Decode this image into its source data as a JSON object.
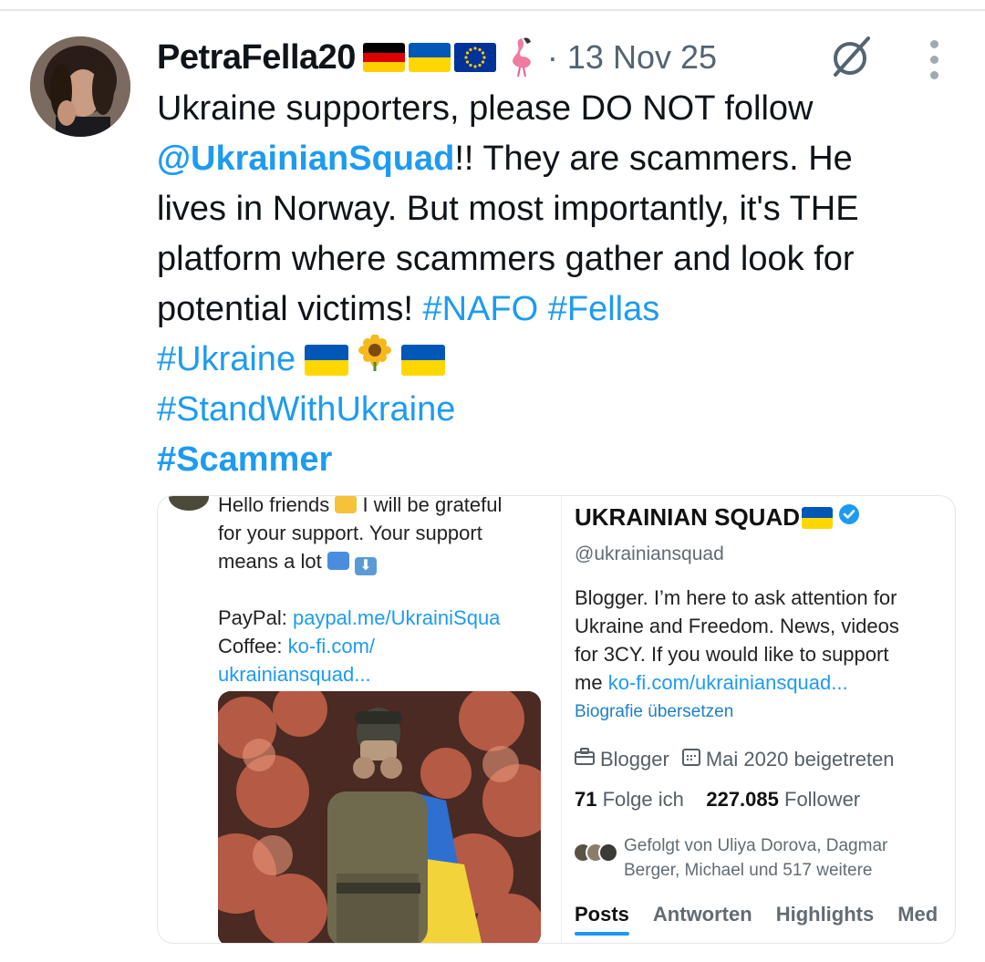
{
  "tweet": {
    "username": "PetraFella20",
    "date": "· 13 Nov 25",
    "text": {
      "l1": "Ukraine supporters, please DO NOT follow",
      "mention": "@UkrainianSquad",
      "l2_rest": "!! They are scammers. He",
      "l3": "lives in Norway. But most importantly, it's THE",
      "l4": "platform where scammers gather and look for",
      "l5_plain": "potential victims!",
      "tag_nafo": "#NAFO",
      "tag_fellas": "#Fellas",
      "tag_ukraine": "#Ukraine",
      "tag_stand": "#StandWithUkraine",
      "tag_scammer": "#Scammer"
    }
  },
  "icons": {
    "name_flags": [
      "flag-germany-icon",
      "flag-ukraine-icon",
      "flag-eu-icon",
      "flamingo-icon"
    ],
    "header": [
      "grok-icon",
      "more-icon"
    ]
  },
  "media": {
    "left": {
      "r1a": "Hello friends",
      "r1b": "I will be grateful",
      "r2": "for your support. Your support",
      "r3": "means a lot",
      "paypal_label": "PayPal:",
      "paypal_link": "paypal.me/UkrainiSqua",
      "coffee_label": "Coffee:",
      "coffee_link": "ko-fi.com/",
      "coffee_link2": "ukrainiansquad..."
    },
    "right": {
      "name": "UKRAINIAN SQUAD",
      "handle": "@ukrainiansquad",
      "bio1": "Blogger. I’m here to ask attention for",
      "bio2": "Ukraine and Freedom. News, videos",
      "bio3": "for 3CY. If you would like to support",
      "bio4a": "me",
      "bio4_link": "ko-fi.com/ukrainiansquad...",
      "translate": "Biografie übersetzen",
      "category": "Blogger",
      "joined": "Mai 2020 beigetreten",
      "following_count": "71",
      "following_label": "Folge ich",
      "followers_count": "227.085",
      "followers_label": "Follower",
      "followed1": "Gefolgt von Uliya Dorova, Dagmar",
      "followed2": "Berger, Michael und 517 weitere",
      "tabs": [
        "Posts",
        "Antworten",
        "Highlights",
        "Med"
      ]
    }
  },
  "colors": {
    "link": "#1d9bf0",
    "text": "#0f1419",
    "muted": "#536471",
    "ukraine_blue": "#0057b7",
    "ukraine_yellow": "#ffd700"
  }
}
